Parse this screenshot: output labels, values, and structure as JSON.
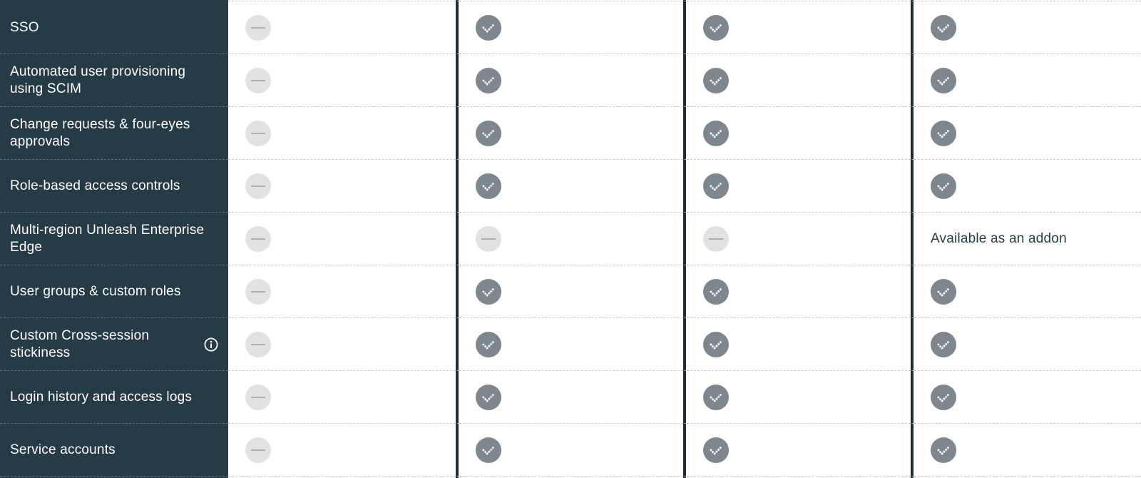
{
  "colors": {
    "label_background": "#253b45",
    "check_background": "#7d878d",
    "none_background": "#e2e2e2",
    "text_dark": "#253b45"
  },
  "icons": {
    "check": "check-icon",
    "none": "dash-icon",
    "info": "info-icon"
  },
  "rows": [
    {
      "label": "SSO",
      "info": false,
      "cells": [
        {
          "type": "none"
        },
        {
          "type": "check"
        },
        {
          "type": "check"
        },
        {
          "type": "check"
        }
      ]
    },
    {
      "label": "Automated user provisioning using SCIM",
      "info": false,
      "cells": [
        {
          "type": "none"
        },
        {
          "type": "check"
        },
        {
          "type": "check"
        },
        {
          "type": "check"
        }
      ]
    },
    {
      "label": "Change requests & four-eyes approvals",
      "info": false,
      "cells": [
        {
          "type": "none"
        },
        {
          "type": "check"
        },
        {
          "type": "check"
        },
        {
          "type": "check"
        }
      ]
    },
    {
      "label": "Role-based access controls",
      "info": false,
      "cells": [
        {
          "type": "none"
        },
        {
          "type": "check"
        },
        {
          "type": "check"
        },
        {
          "type": "check"
        }
      ]
    },
    {
      "label": "Multi-region Unleash Enterprise Edge",
      "info": false,
      "cells": [
        {
          "type": "none"
        },
        {
          "type": "none"
        },
        {
          "type": "none"
        },
        {
          "type": "text",
          "text": "Available as an addon"
        }
      ]
    },
    {
      "label": "User groups & custom roles",
      "info": false,
      "cells": [
        {
          "type": "none"
        },
        {
          "type": "check"
        },
        {
          "type": "check"
        },
        {
          "type": "check"
        }
      ]
    },
    {
      "label": "Custom Cross-session stickiness",
      "info": true,
      "cells": [
        {
          "type": "none"
        },
        {
          "type": "check"
        },
        {
          "type": "check"
        },
        {
          "type": "check"
        }
      ]
    },
    {
      "label": "Login history and access logs",
      "info": false,
      "cells": [
        {
          "type": "none"
        },
        {
          "type": "check"
        },
        {
          "type": "check"
        },
        {
          "type": "check"
        }
      ]
    },
    {
      "label": "Service accounts",
      "info": false,
      "cells": [
        {
          "type": "none"
        },
        {
          "type": "check"
        },
        {
          "type": "check"
        },
        {
          "type": "check"
        }
      ]
    }
  ]
}
